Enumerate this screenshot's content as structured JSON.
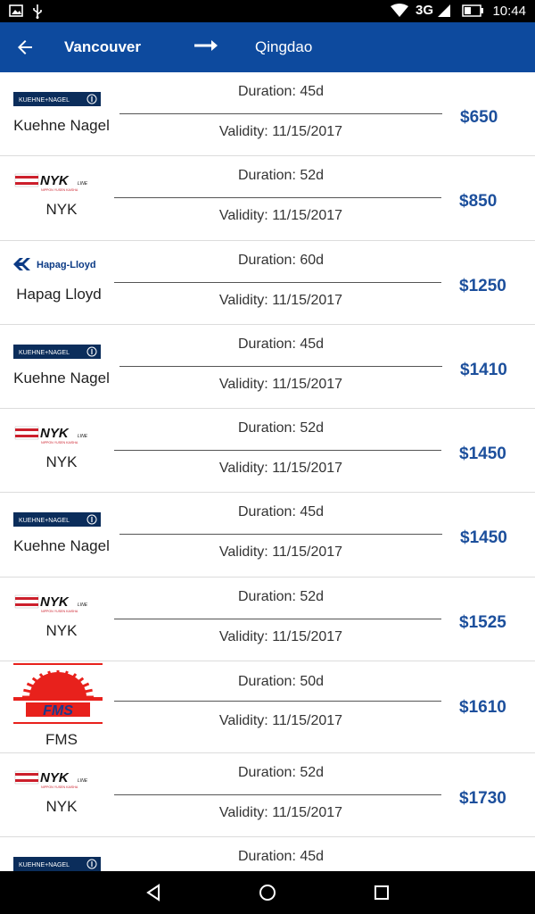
{
  "status_bar": {
    "network": "3G",
    "time": "10:44"
  },
  "header": {
    "origin": "Vancouver",
    "destination": "Qingdao"
  },
  "quotes": [
    {
      "carrier": "Kuehne Nagel",
      "logo": "kuehne-nagel",
      "duration": "Duration: 45d",
      "validity": "Validity: 11/15/2017",
      "price": "$650"
    },
    {
      "carrier": "NYK",
      "logo": "nyk",
      "duration": "Duration: 52d",
      "validity": "Validity: 11/15/2017",
      "price": "$850"
    },
    {
      "carrier": "Hapag Lloyd",
      "logo": "hapag-lloyd",
      "duration": "Duration: 60d",
      "validity": "Validity: 11/15/2017",
      "price": "$1250"
    },
    {
      "carrier": "Kuehne Nagel",
      "logo": "kuehne-nagel",
      "duration": "Duration: 45d",
      "validity": "Validity: 11/15/2017",
      "price": "$1410"
    },
    {
      "carrier": "NYK",
      "logo": "nyk",
      "duration": "Duration: 52d",
      "validity": "Validity: 11/15/2017",
      "price": "$1450"
    },
    {
      "carrier": "Kuehne Nagel",
      "logo": "kuehne-nagel",
      "duration": "Duration: 45d",
      "validity": "Validity: 11/15/2017",
      "price": "$1450"
    },
    {
      "carrier": "NYK",
      "logo": "nyk",
      "duration": "Duration: 52d",
      "validity": "Validity: 11/15/2017",
      "price": "$1525"
    },
    {
      "carrier": "FMS",
      "logo": "fms",
      "duration": "Duration: 50d",
      "validity": "Validity: 11/15/2017",
      "price": "$1610"
    },
    {
      "carrier": "NYK",
      "logo": "nyk",
      "duration": "Duration: 52d",
      "validity": "Validity: 11/15/2017",
      "price": "$1730"
    },
    {
      "carrier": "",
      "logo": "kuehne-nagel",
      "duration": "Duration: 45d",
      "validity": "",
      "price": ""
    }
  ],
  "logo_text": {
    "kuehne_nagel": "KUEHNE+NAGEL",
    "nyk": "NYK",
    "nyk_suffix": "LINE",
    "nyk_sub": "NIPPON YUSEN KAISHA",
    "hapag_lloyd": "Hapag-Lloyd",
    "fms": "FMS"
  },
  "colors": {
    "appbar": "#0d4a9e",
    "price": "#1c4f9c",
    "nyk_red": "#cc1f2b",
    "kn_navy": "#0b2d5b",
    "fms_red": "#e8211c",
    "fms_blue": "#1a3a8c"
  }
}
